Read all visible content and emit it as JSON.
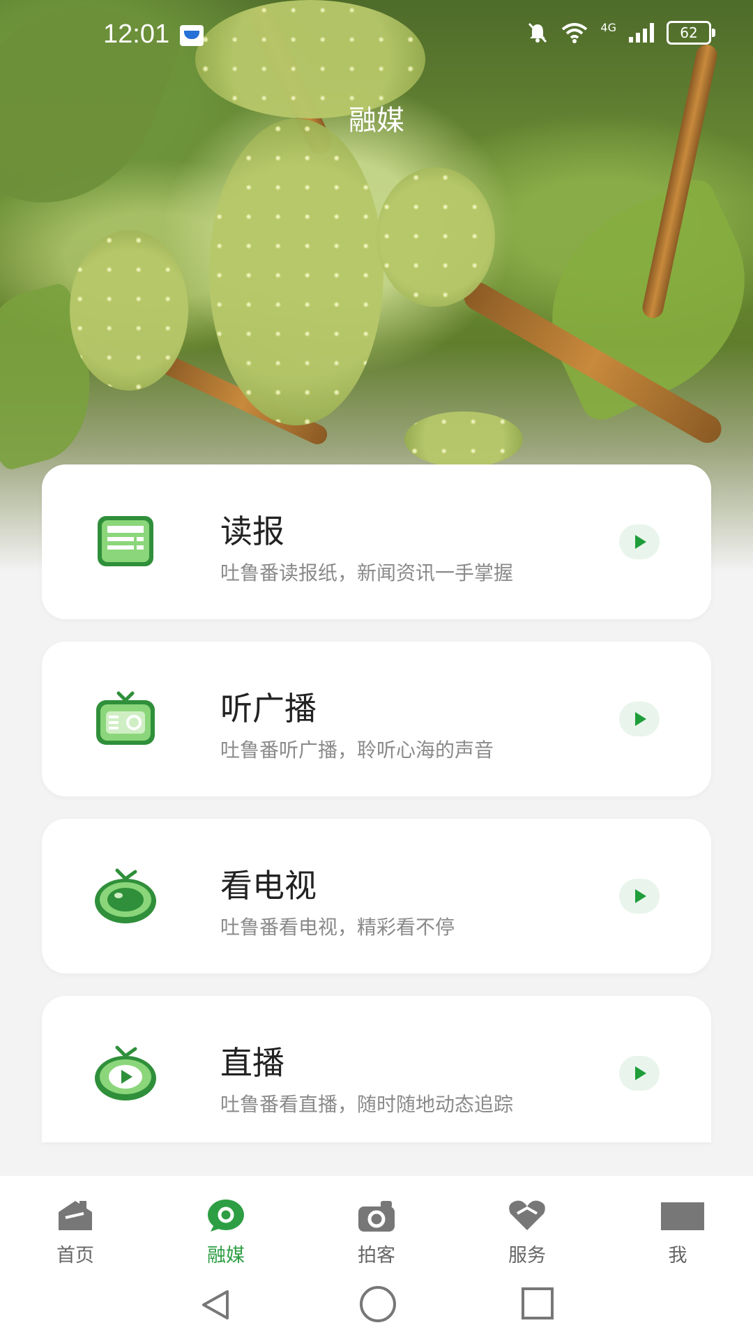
{
  "status_bar": {
    "time": "12:01",
    "network": "4G",
    "battery": "62"
  },
  "header": {
    "title": "融媒"
  },
  "cards": [
    {
      "title": "读报",
      "subtitle": "吐鲁番读报纸，新闻资讯一手掌握",
      "icon": "newspaper-icon"
    },
    {
      "title": "听广播",
      "subtitle": "吐鲁番听广播，聆听心海的声音",
      "icon": "radio-icon"
    },
    {
      "title": "看电视",
      "subtitle": "吐鲁番看电视，精彩看不停",
      "icon": "tv-icon"
    },
    {
      "title": "直播",
      "subtitle": "吐鲁番看直播，随时随地动态追踪",
      "icon": "live-icon"
    }
  ],
  "bottom_nav": [
    {
      "label": "首页",
      "icon": "home-icon",
      "active": false
    },
    {
      "label": "融媒",
      "icon": "media-icon",
      "active": true
    },
    {
      "label": "拍客",
      "icon": "camera-icon",
      "active": false
    },
    {
      "label": "服务",
      "icon": "service-icon",
      "active": false
    },
    {
      "label": "我",
      "icon": "profile-icon",
      "active": false
    }
  ],
  "colors": {
    "accent": "#2e9e44",
    "icon_green": "#4caf50",
    "card_bg": "#ffffff",
    "subtitle": "#8a8a8a"
  }
}
